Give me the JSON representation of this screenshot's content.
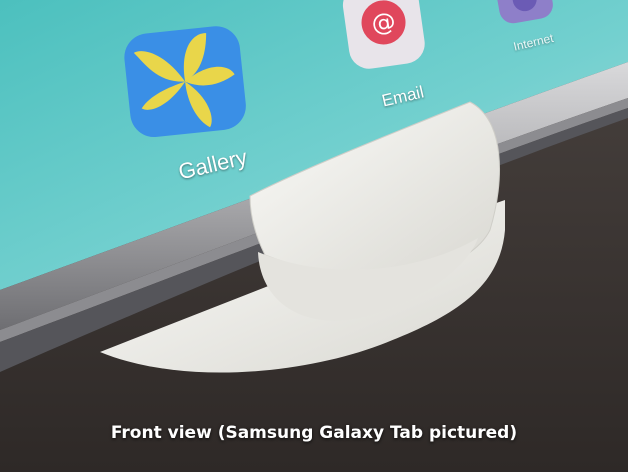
{
  "apps": {
    "gallery": {
      "label": "Gallery",
      "icon": "gallery-leaf-icon"
    },
    "email": {
      "label": "Email",
      "icon": "email-at-icon"
    },
    "internet": {
      "label": "Internet",
      "icon": "internet-globe-icon"
    }
  },
  "caption": "Front view (Samsung Galaxy Tab pictured)",
  "colors": {
    "screen": "#5cc7c6",
    "tablet_frame": "#b9b9bb",
    "stand": "#efeeea",
    "table": "#3a3431",
    "gallery_blue": "#3a8fe6",
    "gallery_yellow": "#e9d64a",
    "email_red": "#e0475c"
  }
}
